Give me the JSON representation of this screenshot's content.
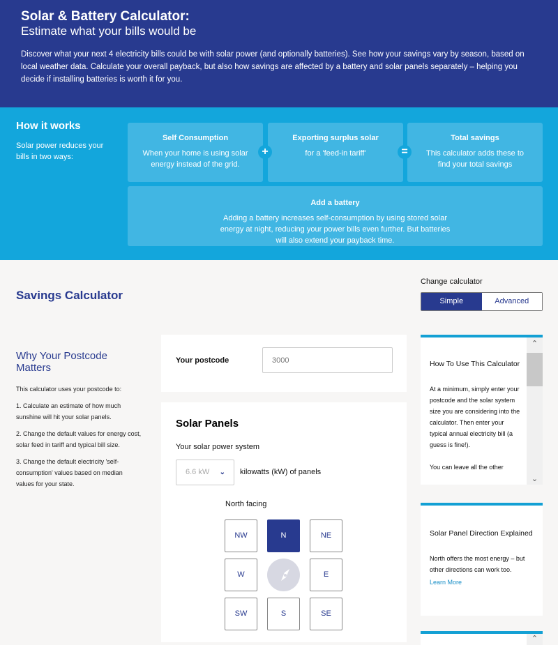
{
  "header": {
    "title": "Solar & Battery Calculator:",
    "subtitle": "Estimate what your bills would be",
    "description": "Discover what your next 4 electricity bills could be with solar power (and optionally batteries). See how your savings vary by season, based on local weather data. Calculate your overall payback, but also how savings are affected by a battery and solar panels separately – helping you decide if installing batteries is worth it for you."
  },
  "how": {
    "title": "How it works",
    "subtitle": "Solar power reduces your bills in two ways:",
    "cards": [
      {
        "title": "Self Consumption",
        "text": "When your home is using solar energy instead of the grid."
      },
      {
        "title": "Exporting surplus solar",
        "text": "for a 'feed-in tariff'"
      },
      {
        "title": "Total savings",
        "text": "This calculator adds these to find your total savings"
      }
    ],
    "plus": "+",
    "equals": "=",
    "battery": {
      "title": "Add a battery",
      "text": "Adding a battery increases self-consumption by using stored solar energy at night, reducing your power bills even further. But batteries will also extend your payback time."
    }
  },
  "calc": {
    "title": "Savings Calculator",
    "change_label": "Change calculator",
    "simple": "Simple",
    "advanced": "Advanced"
  },
  "why": {
    "title": "Why Your Postcode Matters",
    "intro": "This calculator uses your postcode to:",
    "items": [
      "1.  Calculate an estimate of how much sunshine will hit your solar panels.",
      "2.  Change the default values for energy cost, solar feed in tariff and typical bill size.",
      "3.  Change the default electricity 'self-consumption' values based on median values for your state."
    ]
  },
  "postcode": {
    "label": "Your postcode",
    "placeholder": "3000"
  },
  "solar": {
    "title": "Solar Panels",
    "system_label": "Your solar power system",
    "size": "6.6 kW",
    "unit": "kilowatts (kW) of panels",
    "facing": "North facing",
    "directions": [
      "NW",
      "N",
      "NE",
      "W",
      "E",
      "SW",
      "S",
      "SE"
    ],
    "selected": "N"
  },
  "side": [
    {
      "title": "How To Use This Calculator",
      "text": "At a minimum, simply enter your postcode and the solar system size you are considering into the calculator. Then enter your typical annual electricity bill (a guess is fine!).",
      "more": "You can leave all the other"
    },
    {
      "title": "Solar Panel Direction Explained",
      "text": "North offers the most energy – but other directions can work too.",
      "link": "Learn More"
    }
  ],
  "colors": {
    "navy": "#283a8f",
    "blue": "#13a6dc",
    "link": "#1a8fc7"
  }
}
